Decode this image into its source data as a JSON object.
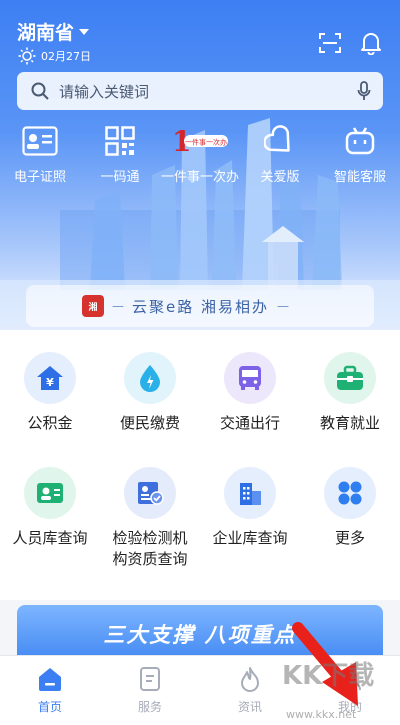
{
  "header": {
    "province": "湖南省",
    "date": "02月27日"
  },
  "search": {
    "placeholder": "请输入关键词"
  },
  "quick_actions": [
    {
      "label": "电子证照",
      "icon": "id-card-icon"
    },
    {
      "label": "一码通",
      "icon": "qr-code-icon"
    },
    {
      "label": "一件事一次办",
      "icon": "one-stop-logo-icon",
      "logo_text": "一件事一次办"
    },
    {
      "label": "关爱版",
      "icon": "heart-care-icon"
    },
    {
      "label": "智能客服",
      "icon": "robot-icon"
    }
  ],
  "slogan": {
    "text": "云聚e路  湘易相办",
    "badge": "湘"
  },
  "services": [
    {
      "label": "公积金",
      "icon": "house-yen-icon",
      "color": "#2f6fe6",
      "bg": "#e4eefc"
    },
    {
      "label": "便民缴费",
      "icon": "water-drop-icon",
      "color": "#2ab0e8",
      "bg": "#e2f4fb"
    },
    {
      "label": "交通出行",
      "icon": "bus-icon",
      "color": "#7d62e8",
      "bg": "#ece7fb"
    },
    {
      "label": "教育就业",
      "icon": "briefcase-icon",
      "color": "#1fb074",
      "bg": "#e0f5eb"
    },
    {
      "label": "人员库查询",
      "icon": "person-card-icon",
      "color": "#1fb074",
      "bg": "#e0f5eb"
    },
    {
      "label": "检验检测机\n构资质查询",
      "icon": "certificate-icon",
      "color": "#3f6fdd",
      "bg": "#e4ebfb"
    },
    {
      "label": "企业库查询",
      "icon": "building-icon",
      "color": "#2f6fe6",
      "bg": "#e4eefc"
    },
    {
      "label": "更多",
      "icon": "more-grid-icon",
      "color": "#2f7ef0",
      "bg": "#e4eefc"
    }
  ],
  "banner": {
    "text": "三大支撑 八项重点"
  },
  "tabs": [
    {
      "label": "首页",
      "icon": "home-icon",
      "active": true
    },
    {
      "label": "服务",
      "icon": "service-doc-icon",
      "active": false
    },
    {
      "label": "资讯",
      "icon": "fire-icon",
      "active": false
    },
    {
      "label": "我的",
      "icon": "user-icon",
      "active": false
    }
  ],
  "watermark": {
    "text": "KK下载",
    "url": "www.kkx.net"
  }
}
